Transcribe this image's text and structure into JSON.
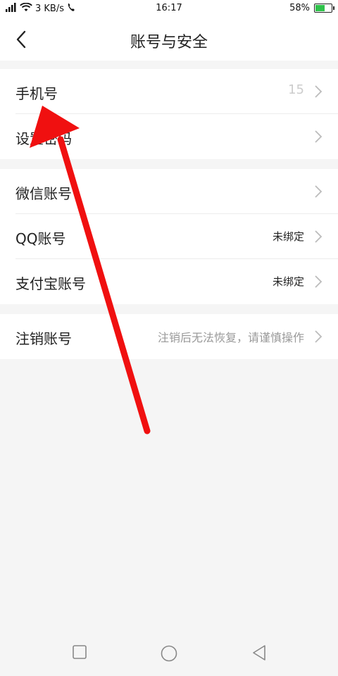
{
  "status_bar": {
    "network": "4G",
    "speed": "3 KB/s",
    "time": "16:17",
    "battery_percent": "58%",
    "battery_level": 0.58,
    "battery_color": "#2ec24a"
  },
  "nav": {
    "title": "账号与安全",
    "back_icon": "chevron-left-icon"
  },
  "groups": [
    {
      "rows": [
        {
          "label": "手机号",
          "value": "15"
        },
        {
          "label": "设置密码",
          "value": ""
        }
      ]
    },
    {
      "rows": [
        {
          "label": "微信账号",
          "value": ""
        },
        {
          "label": "QQ账号",
          "value": "未绑定"
        },
        {
          "label": "支付宝账号",
          "value": "未绑定"
        }
      ]
    },
    {
      "rows": [
        {
          "label": "注销账号",
          "value": "注销后无法恢复，请谨慎操作"
        }
      ]
    }
  ],
  "colors": {
    "annotation_arrow": "#f01010",
    "background": "#f5f5f5"
  }
}
